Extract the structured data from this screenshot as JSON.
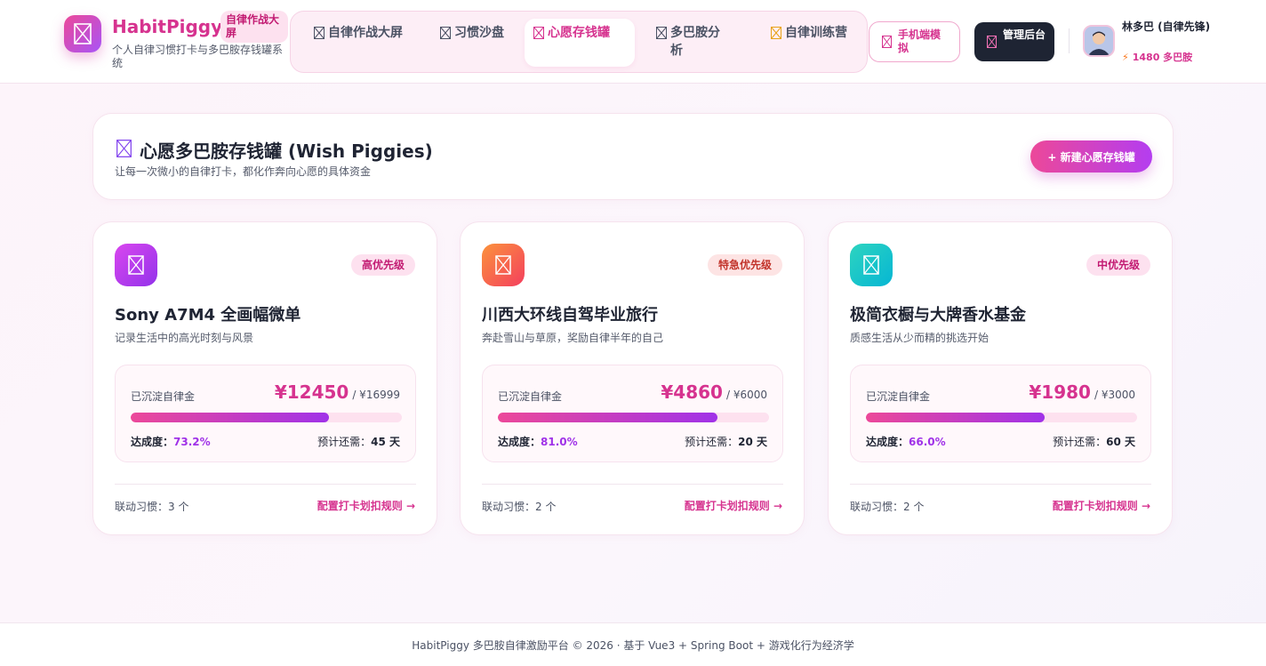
{
  "header": {
    "brand_name": "HabitPiggy",
    "brand_badge": "自律作战大屏",
    "brand_sub": "个人自律习惯打卡与多巴胺存钱罐系统",
    "nav": [
      {
        "label": "自律作战大屏",
        "icon": "dashboard-icon"
      },
      {
        "label": "习惯沙盘",
        "icon": "sandbox-icon"
      },
      {
        "label": "心愿存钱罐",
        "icon": "piggy-icon"
      },
      {
        "label": "多巴胺分析",
        "icon": "chart-icon"
      },
      {
        "label": "自律训练营",
        "icon": "camp-icon"
      }
    ],
    "mobile_btn": "手机端模拟",
    "admin_btn": "管理后台",
    "user_name": "林多巴 (自律先锋)",
    "user_coins": "1480 多巴胺"
  },
  "page": {
    "title": "心愿多巴胺存钱罐 (Wish Piggies)",
    "subtitle": "让每一次微小的自律打卡，都化作奔向心愿的具体资金",
    "new_btn": "+ 新建心愿存钱罐"
  },
  "labels": {
    "fund": "已沉淀自律金",
    "rate": "达成度：",
    "days": "预计还需：",
    "linked": "联动习惯：",
    "config": "配置打卡划扣规则 →"
  },
  "wishes": [
    {
      "priority": "高优先级",
      "title": "Sony A7M4 全画幅微单",
      "desc": "记录生活中的高光时刻与风景",
      "amount": "¥12450",
      "target": "/ ¥16999",
      "progress": 0.732,
      "rate": "73.2%",
      "days": "45 天",
      "linked": "3 个",
      "colors": [
        "#d946ef",
        "#9333ea"
      ]
    },
    {
      "priority": "特急优先级",
      "title": "川西大环线自驾毕业旅行",
      "desc": "奔赴雪山与草原，奖励自律半年的自己",
      "amount": "¥4860",
      "target": "/ ¥6000",
      "progress": 0.81,
      "rate": "81.0%",
      "days": "20 天",
      "linked": "2 个",
      "colors": [
        "#fb923c",
        "#f43f5e"
      ]
    },
    {
      "priority": "中优先级",
      "title": "极简衣橱与大牌香水基金",
      "desc": "质感生活从少而精的挑选开始",
      "amount": "¥1980",
      "target": "/ ¥3000",
      "progress": 0.66,
      "rate": "66.0%",
      "days": "60 天",
      "linked": "2 个",
      "colors": [
        "#2dd4bf",
        "#06b6d4"
      ]
    }
  ],
  "footer": "HabitPiggy 多巴胺自律激励平台 © 2026 · 基于 Vue3 + Spring Boot + 游戏化行为经济学"
}
